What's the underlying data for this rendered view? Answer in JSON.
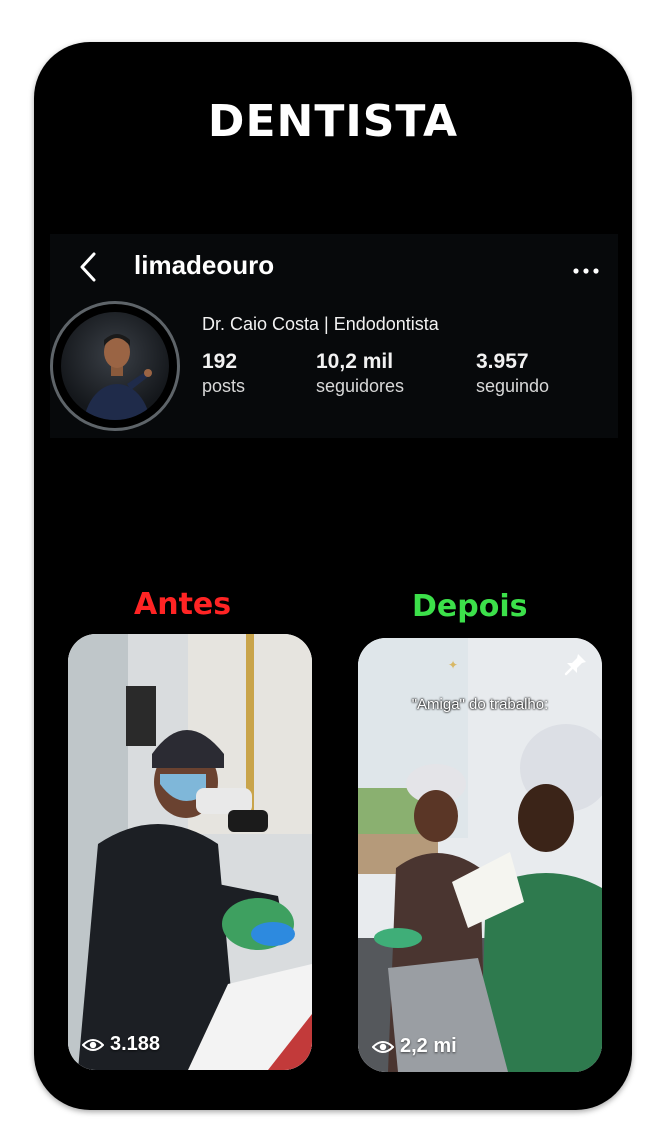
{
  "headline": "DENTISTA",
  "profile": {
    "username": "limadeouro",
    "display_name": "Dr. Caio Costa | Endodontista",
    "stats": [
      {
        "value": "192",
        "label": "posts"
      },
      {
        "value": "10,2 mil",
        "label": "seguidores"
      },
      {
        "value": "3.957",
        "label": "seguindo"
      }
    ]
  },
  "comparison": {
    "before_label": "Antes",
    "after_label": "Depois",
    "before_color": "#ff2424",
    "after_color": "#3ce04a"
  },
  "posts": [
    {
      "views": "3.188",
      "icon": "eye-icon"
    },
    {
      "views": "2,2 mi",
      "caption": "\"Amiga\" do trabalho:",
      "pinned": true,
      "icon": "pin-icon"
    }
  ]
}
